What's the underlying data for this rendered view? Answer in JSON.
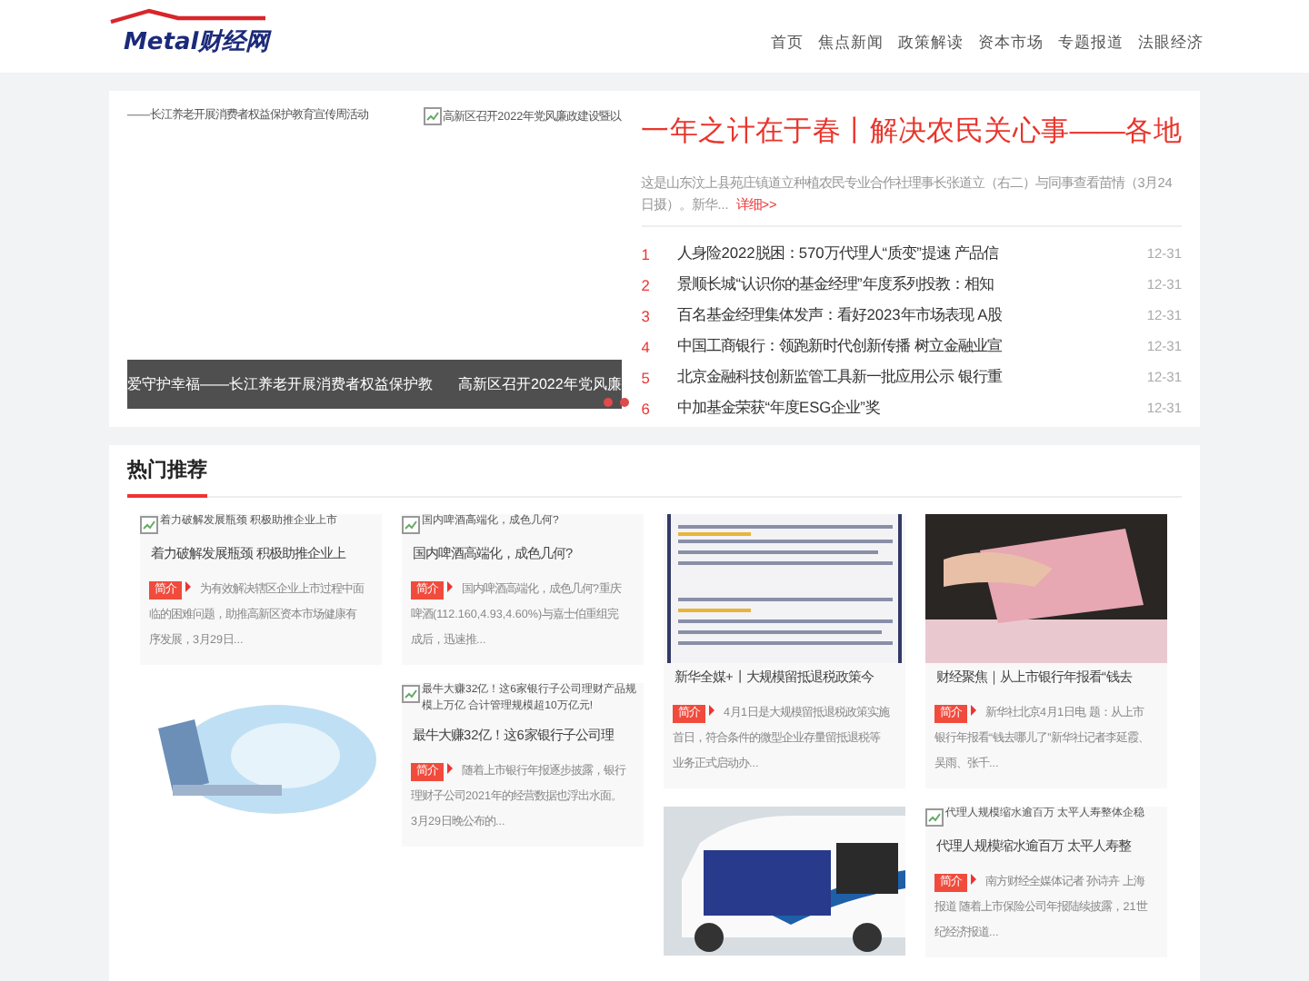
{
  "header": {
    "logo": "Metal财经网",
    "nav": [
      {
        "label": "首页",
        "selected": false
      },
      {
        "label": "焦点新闻",
        "selected": false
      },
      {
        "label": "政策解读",
        "selected": false
      },
      {
        "label": "资本市场",
        "selected": false
      },
      {
        "label": "专题报道",
        "selected": false
      },
      {
        "label": "法眼经济",
        "selected": false
      }
    ]
  },
  "slider": {
    "top_caption": "——长江养老开展消费者权益保护教育宣传周活动",
    "broken_image_alt": "高新区召开2022年党风廉政建设暨以",
    "bar_captions": [
      "爱守护幸福——长江养老开展消费者权益保护教",
      "高新区召开2022年党风廉"
    ]
  },
  "headline": {
    "title": "一年之计在于春丨解决农民关心事——各地",
    "summary": "这是山东汶上县苑庄镇道立种植农民专业合作社理事长张道立（右二）与同事查看苗情（3月24日摄）。新华...",
    "more_link": "详细>>"
  },
  "news": [
    {
      "number": "1",
      "title": "人身险2022脱困：570万代理人“质变”提速 产品信",
      "date": "12-31"
    },
    {
      "number": "2",
      "title": "景顺长城“认识你的基金经理”年度系列投教：相知",
      "date": "12-31"
    },
    {
      "number": "3",
      "title": "百名基金经理集体发声：看好2023年市场表现 A股",
      "date": "12-31"
    },
    {
      "number": "4",
      "title": "中国工商银行：领跑新时代创新传播 树立金融业宣",
      "date": "12-31"
    },
    {
      "number": "5",
      "title": "北京金融科技创新监管工具新一批应用公示 银行重",
      "date": "12-31"
    },
    {
      "number": "6",
      "title": "中加基金荣获“年度ESG企业”奖",
      "date": "12-31"
    }
  ],
  "hot": {
    "title": "热门推荐",
    "columns": [
      [
        {
          "kind": "broken",
          "alt": "着力破解发展瓶颈 积极助推企业上市",
          "title": "着力破解发展瓶颈 积极助推企业上",
          "tag": "简介",
          "intro": "为有效解决辖区企业上市过程中面临的困难问题，助推高新区资本市场健康有序发展，3月29日..."
        },
        {
          "kind": "illustration"
        }
      ],
      [
        {
          "kind": "broken",
          "alt": "国内啤酒高端化，成色几何?",
          "title": "国内啤酒高端化，成色几何?",
          "tag": "简介",
          "intro": "国内啤酒高端化，成色几何?重庆啤酒(112.160,4.93,4.60%)与嘉士伯重组完成后，迅速推..."
        },
        {
          "kind": "broken",
          "alt": "最牛大赚32亿！这6家银行子公司理财产品规模上万亿 合计管理规模超10万亿元!",
          "title": "最牛大赚32亿！这6家银行子公司理",
          "tag": "简介",
          "intro": "随着上市银行年报逐步披露，银行理财子公司2021年的经营数据也浮出水面。3月29日晚公布的..."
        }
      ],
      [
        {
          "kind": "document",
          "title": "新华全媒+丨大规模留抵退税政策今",
          "tag": "简介",
          "intro": "4月1日是大规模留抵退税政策实施首日，符合条件的微型企业存量留抵退税等业务正式启动办..."
        },
        {
          "kind": "vehicle"
        }
      ],
      [
        {
          "kind": "money",
          "title": "财经聚焦｜从上市银行年报看“钱去",
          "tag": "简介",
          "intro": "新华社北京4月1日电 题：从上市银行年报看“钱去哪儿了”新华社记者李延霞、吴雨、张千..."
        },
        {
          "kind": "broken",
          "alt": "代理人规模缩水逾百万 太平人寿整体企稳",
          "title": "代理人规模缩水逾百万 太平人寿整",
          "tag": "简介",
          "intro": "南方财经全媒体记者 孙诗卉 上海报道 随着上市保险公司年报陆续披露，21世纪经济报道..."
        }
      ]
    ]
  }
}
